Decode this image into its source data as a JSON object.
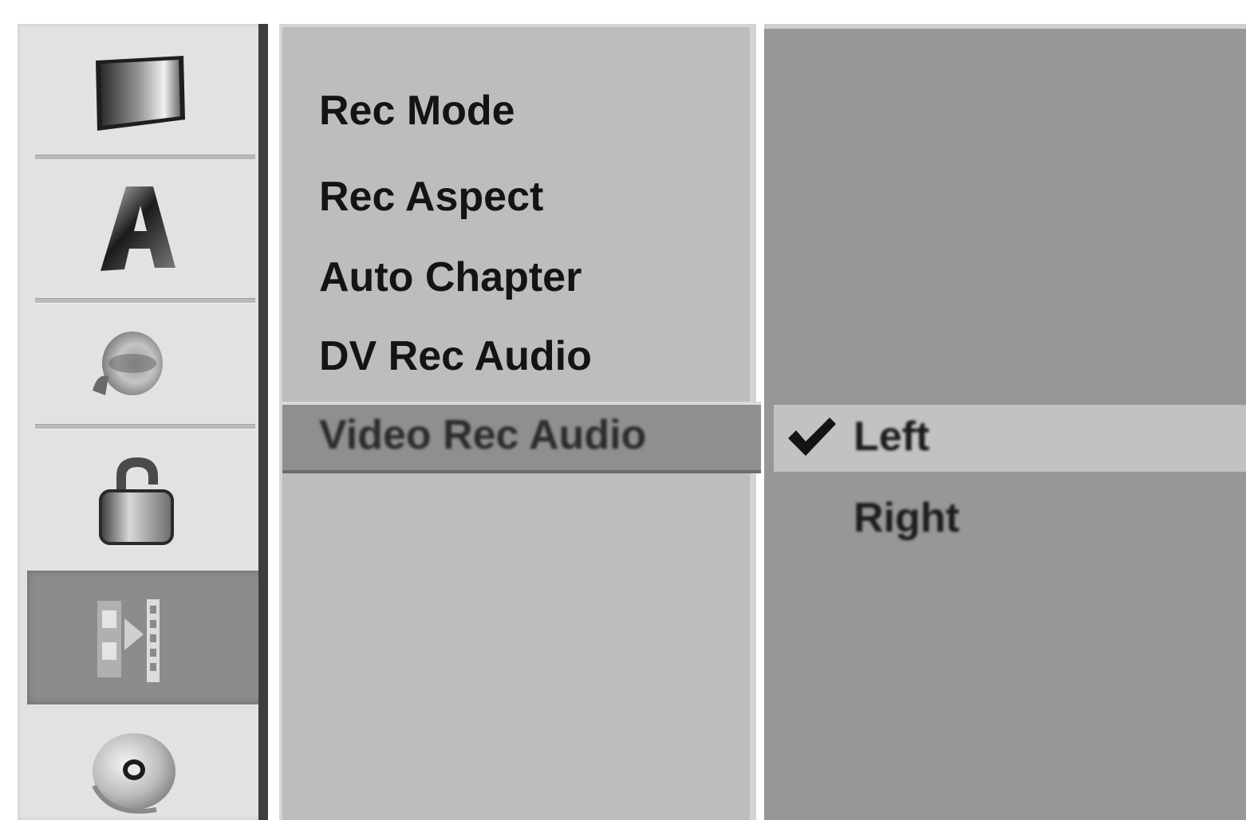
{
  "sidebar": {
    "items": [
      {
        "icon": "tv-screen-icon"
      },
      {
        "icon": "letter-a-icon"
      },
      {
        "icon": "speaker-icon"
      },
      {
        "icon": "padlock-icon"
      },
      {
        "icon": "recording-film-icon",
        "selected": true
      },
      {
        "icon": "disc-icon"
      }
    ]
  },
  "menu": {
    "items": [
      {
        "label": "Rec Mode"
      },
      {
        "label": "Rec Aspect"
      },
      {
        "label": "Auto Chapter"
      },
      {
        "label": "DV Rec Audio"
      },
      {
        "label": "Video Rec Audio",
        "selected": true
      }
    ]
  },
  "options": {
    "items": [
      {
        "label": "Left",
        "checked": true
      },
      {
        "label": "Right",
        "checked": false
      }
    ]
  },
  "colors": {
    "sidebar_bg": "#e2e2e2",
    "selected_sidebar_bg": "#8c8c8c",
    "menu_bg": "#bdbdbd",
    "menu_highlight": "#8f8f8f",
    "value_bg": "#979797",
    "value_highlight": "#c2c2c2",
    "text": "#141414"
  }
}
